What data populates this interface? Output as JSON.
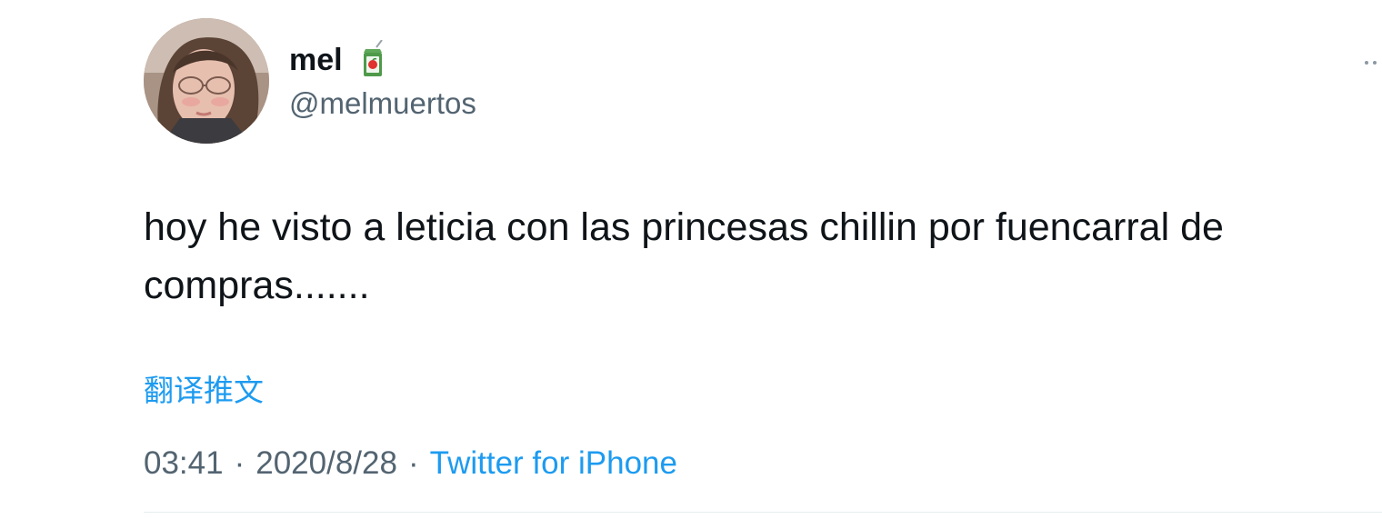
{
  "tweet": {
    "author": {
      "display_name": "mel",
      "name_emoji": "juice-box-icon",
      "handle": "@melmuertos"
    },
    "text": "hoy he visto a leticia con las princesas chillin por fuencarral de compras.......",
    "translate_label": "翻译推文",
    "time": "03:41",
    "date": "2020/8/28",
    "separator": "·",
    "source": "Twitter for iPhone",
    "more_icon": "more-horizontal-icon"
  },
  "colors": {
    "link": "#1d9bf0",
    "secondary_text": "#536471",
    "primary_text": "#0f1419",
    "divider": "#e6ecf0"
  }
}
